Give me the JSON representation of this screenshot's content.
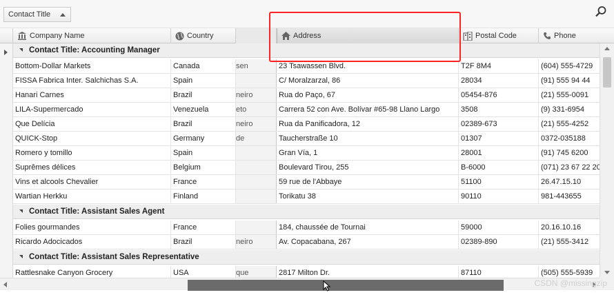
{
  "group_panel": {
    "chip_label": "Contact Title"
  },
  "columns": {
    "company": "Company Name",
    "country": "Country",
    "address": "Address",
    "postal": "Postal Code",
    "phone": "Phone"
  },
  "groups": [
    {
      "label": "Contact Title: Accounting Manager",
      "rows": [
        {
          "company": "Bottom-Dollar Markets",
          "country": "Canada",
          "city": "sen",
          "address": "23 Tsawassen Blvd.",
          "postal": "T2F 8M4",
          "phone": "(604) 555-4729"
        },
        {
          "company": "FISSA Fabrica Inter. Salchichas S.A.",
          "country": "Spain",
          "city": "",
          "address": "C/ Moralzarzal, 86",
          "postal": "28034",
          "phone": "(91) 555 94 44"
        },
        {
          "company": "Hanari Carnes",
          "country": "Brazil",
          "city": "neiro",
          "address": "Rua do Paço, 67",
          "postal": "05454-876",
          "phone": "(21) 555-0091"
        },
        {
          "company": "LILA-Supermercado",
          "country": "Venezuela",
          "city": "eto",
          "address": "Carrera 52 con Ave. Bolívar #65-98 Llano Largo",
          "postal": "3508",
          "phone": "(9) 331-6954"
        },
        {
          "company": "Que Delícia",
          "country": "Brazil",
          "city": "neiro",
          "address": "Rua da Panificadora, 12",
          "postal": "02389-673",
          "phone": "(21) 555-4252"
        },
        {
          "company": "QUICK-Stop",
          "country": "Germany",
          "city": "de",
          "address": "Taucherstraße 10",
          "postal": "01307",
          "phone": "0372-035188"
        },
        {
          "company": "Romero y tomillo",
          "country": "Spain",
          "city": "",
          "address": "Gran Vía, 1",
          "postal": "28001",
          "phone": "(91) 745 6200"
        },
        {
          "company": "Suprêmes délices",
          "country": "Belgium",
          "city": "",
          "address": "Boulevard Tirou, 255",
          "postal": "B-6000",
          "phone": "(071) 23 67 22 20"
        },
        {
          "company": "Vins et alcools Chevalier",
          "country": "France",
          "city": "",
          "address": "59 rue de l'Abbaye",
          "postal": "51100",
          "phone": "26.47.15.10"
        },
        {
          "company": "Wartian Herkku",
          "country": "Finland",
          "city": "",
          "address": "Torikatu 38",
          "postal": "90110",
          "phone": "981-443655"
        }
      ]
    },
    {
      "label": "Contact Title: Assistant Sales Agent",
      "rows": [
        {
          "company": "Folies gourmandes",
          "country": "France",
          "city": "",
          "address": "184, chaussée de Tournai",
          "postal": "59000",
          "phone": "20.16.10.16"
        },
        {
          "company": "Ricardo Adocicados",
          "country": "Brazil",
          "city": "neiro",
          "address": "Av. Copacabana, 267",
          "postal": "02389-890",
          "phone": "(21) 555-3412"
        }
      ]
    },
    {
      "label": "Contact Title: Assistant Sales Representative",
      "rows": [
        {
          "company": "Rattlesnake Canyon Grocery",
          "country": "USA",
          "city": "que",
          "address": "2817 Milton Dr.",
          "postal": "87110",
          "phone": "(505) 555-5939"
        }
      ]
    }
  ],
  "watermark": "CSDN @missingzip"
}
